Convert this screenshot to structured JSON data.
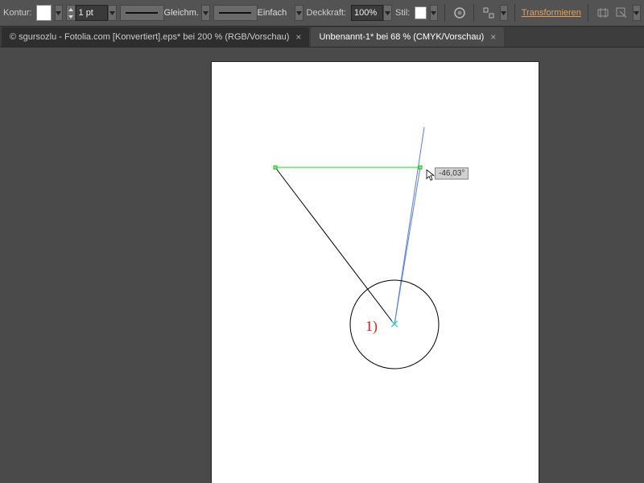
{
  "toolbar": {
    "stroke_label": "Kontur:",
    "weight": "1 pt",
    "dash_label": "Gleichm.",
    "brush_label": "Einfach",
    "opacity_label": "Deckkraft:",
    "opacity_value": "100%",
    "style_label": "Stil:",
    "transform_label": "Transformieren"
  },
  "tabs": {
    "inactive": "© sgursozlu - Fotolia.com [Konvertiert].eps* bei 200 % (RGB/Vorschau)",
    "active": "Unbenannt-1* bei 68 % (CMYK/Vorschau)"
  },
  "canvas": {
    "angle_readout": "-46,03°",
    "step_label": "1)"
  }
}
